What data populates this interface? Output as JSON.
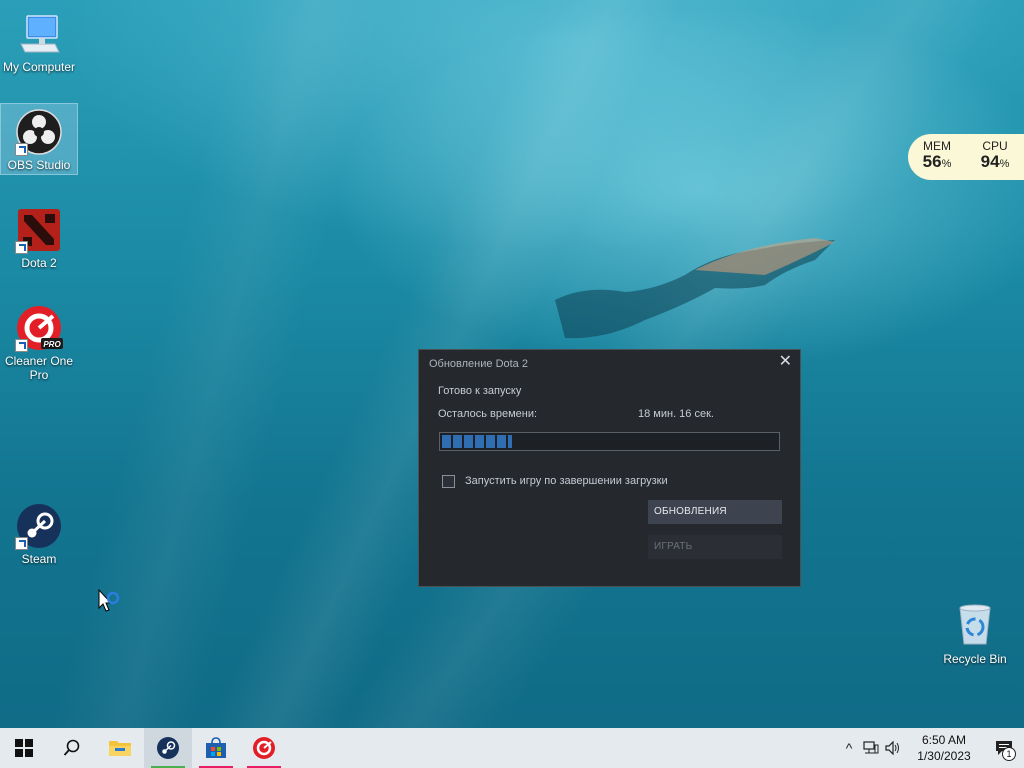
{
  "desktop": {
    "icons": [
      {
        "label": "My Computer",
        "icon": "computer-icon"
      },
      {
        "label": "OBS Studio",
        "icon": "obs-icon"
      },
      {
        "label": "Dota 2",
        "icon": "dota2-icon"
      },
      {
        "label": "Cleaner One Pro",
        "icon": "cleaner-one-icon",
        "badge": "PRO"
      },
      {
        "label": "Steam",
        "icon": "steam-icon"
      },
      {
        "label": "Recycle Bin",
        "icon": "recycle-bin-icon"
      }
    ]
  },
  "perf_widget": {
    "mem_label": "MEM",
    "mem_value": "56",
    "mem_unit": "%",
    "cpu_label": "CPU",
    "cpu_value": "94",
    "cpu_unit": "%"
  },
  "dialog": {
    "title": "Обновление Dota 2",
    "close_glyph": "✕",
    "status": "Готово к запуску",
    "time_label": "Осталось времени:",
    "time_value": "18 мин. 16 сек.",
    "progress_fraction": 0.21,
    "checkbox_label": "Запустить игру по завершении загрузки",
    "checkbox_checked": false,
    "update_button": "ОБНОВЛЕНИЯ",
    "play_button": "ИГРАТЬ"
  },
  "taskbar": {
    "apps": [
      {
        "name": "start",
        "icon": "windows-icon"
      },
      {
        "name": "search",
        "icon": "search-icon"
      },
      {
        "name": "file-explorer",
        "icon": "folder-icon"
      },
      {
        "name": "steam",
        "icon": "steam-icon",
        "active": true,
        "underline": "#4caf50"
      },
      {
        "name": "store",
        "icon": "store-icon",
        "underline": "#e91e63"
      },
      {
        "name": "cleaner-one",
        "icon": "cleaner-one-icon",
        "underline": "#e91e63"
      }
    ],
    "tray": {
      "chevron": "^",
      "time": "6:50 AM",
      "date": "1/30/2023",
      "notification_count": "1"
    }
  },
  "colors": {
    "dialog_bg": "#25282d",
    "progress": "#2f6eb3",
    "taskbar": "#e4eaee"
  }
}
